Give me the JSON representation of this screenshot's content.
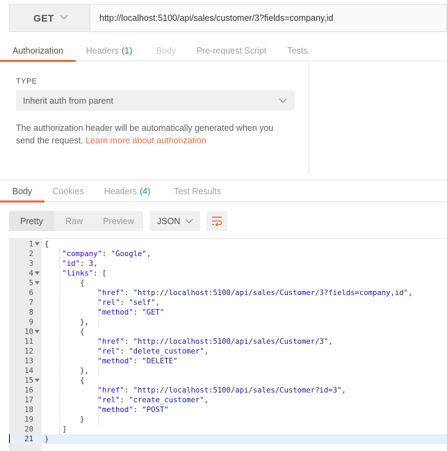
{
  "request": {
    "method": "GET",
    "url": "http://localhost:5100/api/sales/customer/3?fields=company,id"
  },
  "request_tabs": [
    {
      "label": "Authorization",
      "count": "",
      "active": true
    },
    {
      "label": "Headers",
      "count": "(1)",
      "active": false
    },
    {
      "label": "Body",
      "count": "",
      "active": false
    },
    {
      "label": "Pre-request Script",
      "count": "",
      "active": false
    },
    {
      "label": "Tests",
      "count": "",
      "active": false
    }
  ],
  "auth": {
    "type_label": "TYPE",
    "type_value": "Inherit auth from parent",
    "description": "The authorization header will be automatically generated when you send the request.",
    "link_text": "Learn more about authorization"
  },
  "response_tabs": [
    {
      "label": "Body",
      "count": "",
      "active": true
    },
    {
      "label": "Cookies",
      "count": "",
      "active": false
    },
    {
      "label": "Headers",
      "count": "(4)",
      "active": false
    },
    {
      "label": "Test Results",
      "count": "",
      "active": false
    }
  ],
  "response_view": {
    "modes": [
      "Pretty",
      "Raw",
      "Preview"
    ],
    "active_mode": "Pretty",
    "format": "JSON"
  },
  "colors": {
    "accent": "#f26b3a",
    "count": "#2277c8"
  },
  "code_lines": [
    {
      "n": "1",
      "text": "{",
      "fold": true
    },
    {
      "n": "2",
      "text": "    \"company\": \"Google\",",
      "fold": false
    },
    {
      "n": "3",
      "text": "    \"id\": 3,",
      "fold": false
    },
    {
      "n": "4",
      "text": "    \"links\": [",
      "fold": true
    },
    {
      "n": "5",
      "text": "        {",
      "fold": true
    },
    {
      "n": "6",
      "text": "            \"href\": \"http://localhost:5100/api/sales/Customer/3?fields=company,id\",",
      "fold": false
    },
    {
      "n": "7",
      "text": "            \"rel\": \"self\",",
      "fold": false
    },
    {
      "n": "8",
      "text": "            \"method\": \"GET\"",
      "fold": false
    },
    {
      "n": "9",
      "text": "        },",
      "fold": false
    },
    {
      "n": "10",
      "text": "        {",
      "fold": true
    },
    {
      "n": "11",
      "text": "            \"href\": \"http://localhost:5100/api/sales/Customer/3\",",
      "fold": false
    },
    {
      "n": "12",
      "text": "            \"rel\": \"delete_customer\",",
      "fold": false
    },
    {
      "n": "13",
      "text": "            \"method\": \"DELETE\"",
      "fold": false
    },
    {
      "n": "14",
      "text": "        },",
      "fold": false
    },
    {
      "n": "15",
      "text": "        {",
      "fold": true
    },
    {
      "n": "16",
      "text": "            \"href\": \"http://localhost:5100/api/sales/Customer?id=3\",",
      "fold": false
    },
    {
      "n": "17",
      "text": "            \"rel\": \"create_customer\",",
      "fold": false
    },
    {
      "n": "18",
      "text": "            \"method\": \"POST\"",
      "fold": false
    },
    {
      "n": "19",
      "text": "        }",
      "fold": false
    },
    {
      "n": "20",
      "text": "    ]",
      "fold": false
    },
    {
      "n": "21",
      "text": "}",
      "fold": false,
      "cursor": true
    }
  ]
}
